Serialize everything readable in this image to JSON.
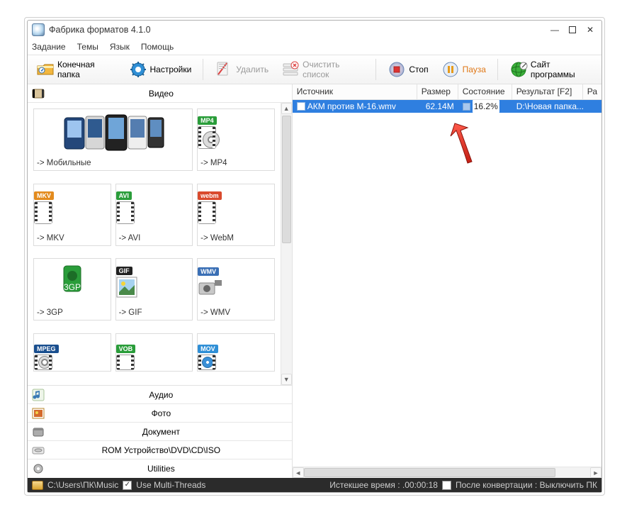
{
  "window": {
    "title": "Фабрика форматов 4.1.0"
  },
  "menu": {
    "task": "Задание",
    "themes": "Темы",
    "lang": "Язык",
    "help": "Помощь"
  },
  "toolbar": {
    "out_folder": "Конечная папка",
    "settings": "Настройки",
    "remove": "Удалить",
    "clear": "Очистить список",
    "stop": "Стоп",
    "pause": "Пауза",
    "site": "Сайт программы"
  },
  "sidebar": {
    "header": "Видео",
    "tiles": {
      "mobile": "->  Мобильные",
      "mp4": "->  MP4",
      "mkv": "->  MKV",
      "avi": "->  AVI",
      "webm": "->  WebM",
      "gp3": "->  3GP",
      "gif": "->  GIF",
      "wmv": "->  WMV",
      "mpeg": "",
      "vob": "",
      "mov": ""
    },
    "cats": {
      "audio": "Аудио",
      "photo": "Фото",
      "doc": "Документ",
      "rom": "ROM Устройство\\DVD\\CD\\ISO",
      "util": "Utilities"
    }
  },
  "table": {
    "cols": {
      "source": "Источник",
      "size": "Размер",
      "state": "Состояние",
      "result": "Результат [F2]",
      "ra": "Ра"
    },
    "row1": {
      "source": "АКМ против М-16.wmv",
      "size": "62.14M",
      "state": "16.2%",
      "result": "D:\\Новая папка..."
    }
  },
  "status": {
    "path": "C:\\Users\\ПК\\Music",
    "mt": "Use Multi-Threads",
    "elapsed": "Истекшее время : .00:00:18",
    "after": "После конвертации : Выключить ПК"
  }
}
